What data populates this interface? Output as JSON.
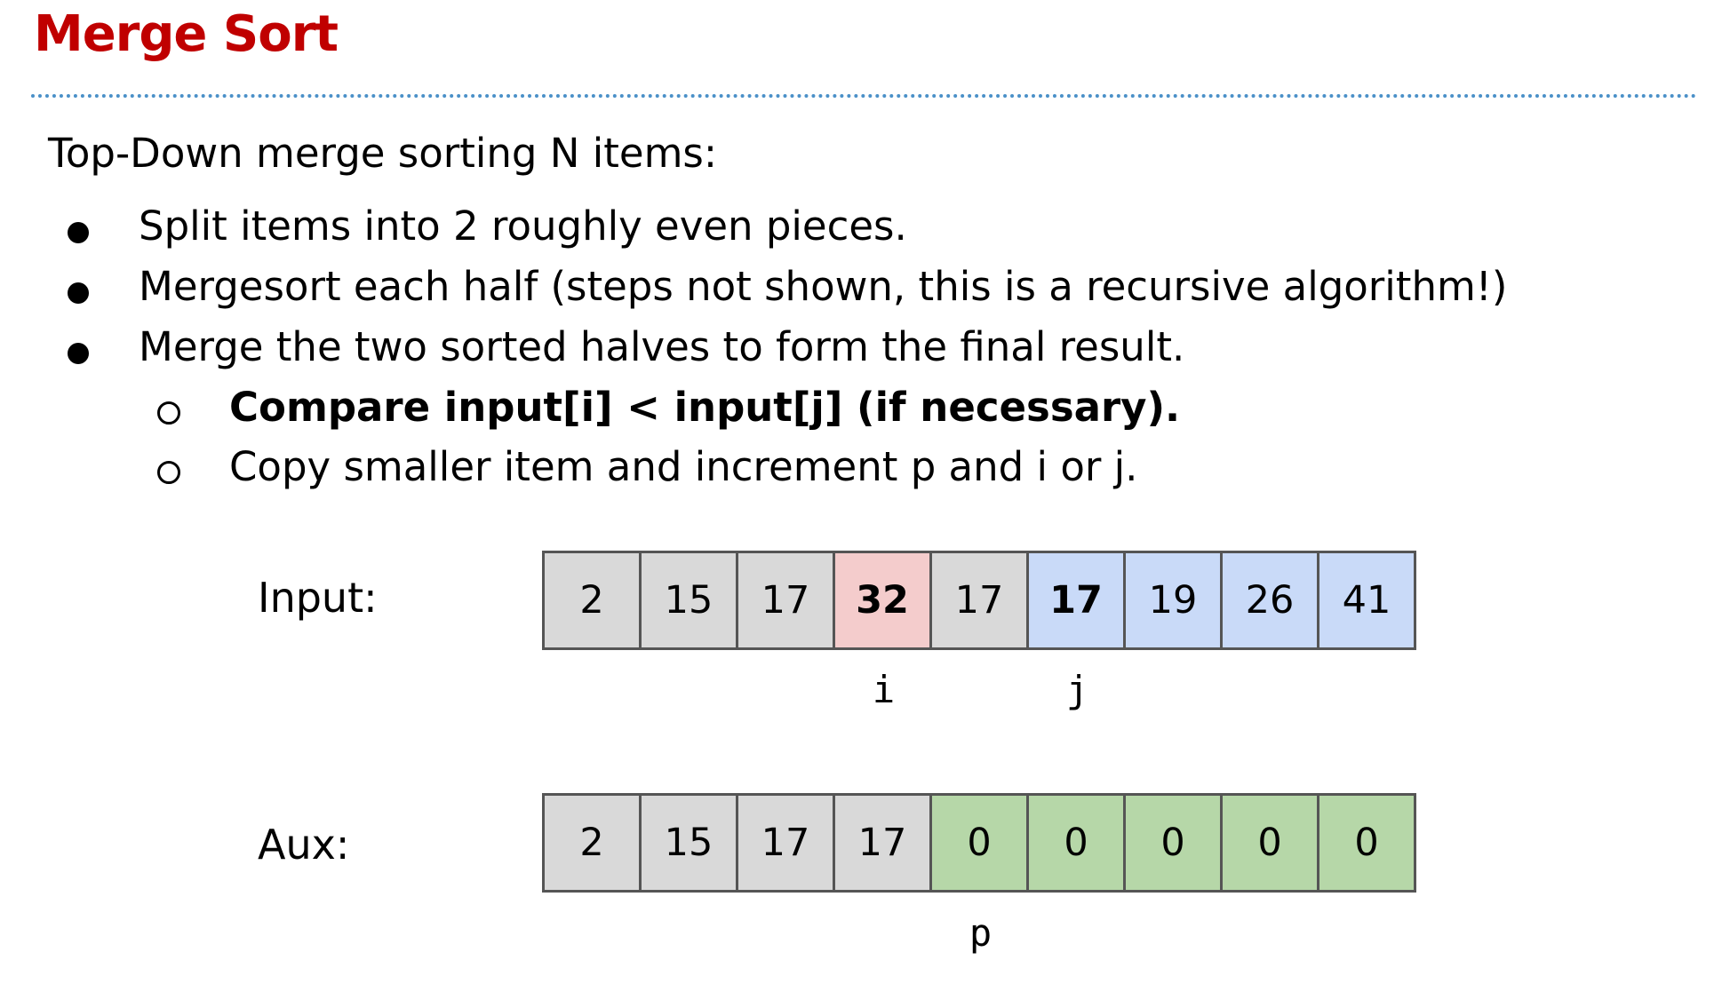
{
  "slide": {
    "title": "Merge Sort",
    "intro": "Top-Down merge sorting N items:",
    "bullets": [
      "Split items into 2 roughly even pieces.",
      "Mergesort each half (steps not shown, this is a recursive algorithm!)",
      "Merge the two sorted halves to form the final result."
    ],
    "sub_bullets": [
      "Compare input[i] < input[j] (if necessary).",
      "Copy smaller item and increment p and i or j."
    ]
  },
  "input_array": {
    "label": "Input:",
    "cells": [
      "2",
      "15",
      "17",
      "32",
      "17",
      "17",
      "19",
      "26",
      "41"
    ],
    "highlight": {
      "pink": [
        3
      ],
      "blue": [
        5,
        6,
        7,
        8
      ],
      "bold": [
        3,
        5
      ]
    },
    "pointers": [
      {
        "name": "i",
        "index": 3
      },
      {
        "name": "j",
        "index": 5
      }
    ]
  },
  "aux_array": {
    "label": "Aux:",
    "cells": [
      "2",
      "15",
      "17",
      "17",
      "0",
      "0",
      "0",
      "0",
      "0"
    ],
    "highlight": {
      "green": [
        4,
        5,
        6,
        7,
        8
      ]
    },
    "pointers": [
      {
        "name": "p",
        "index": 4
      }
    ]
  },
  "colors": {
    "title": "#c00000",
    "rule": "#4a90c8",
    "cell_default": "#d9d9d9",
    "cell_pink": "#f4cccc",
    "cell_blue": "#c9daf8",
    "cell_green": "#b6d7a8",
    "cell_border": "#555555"
  }
}
